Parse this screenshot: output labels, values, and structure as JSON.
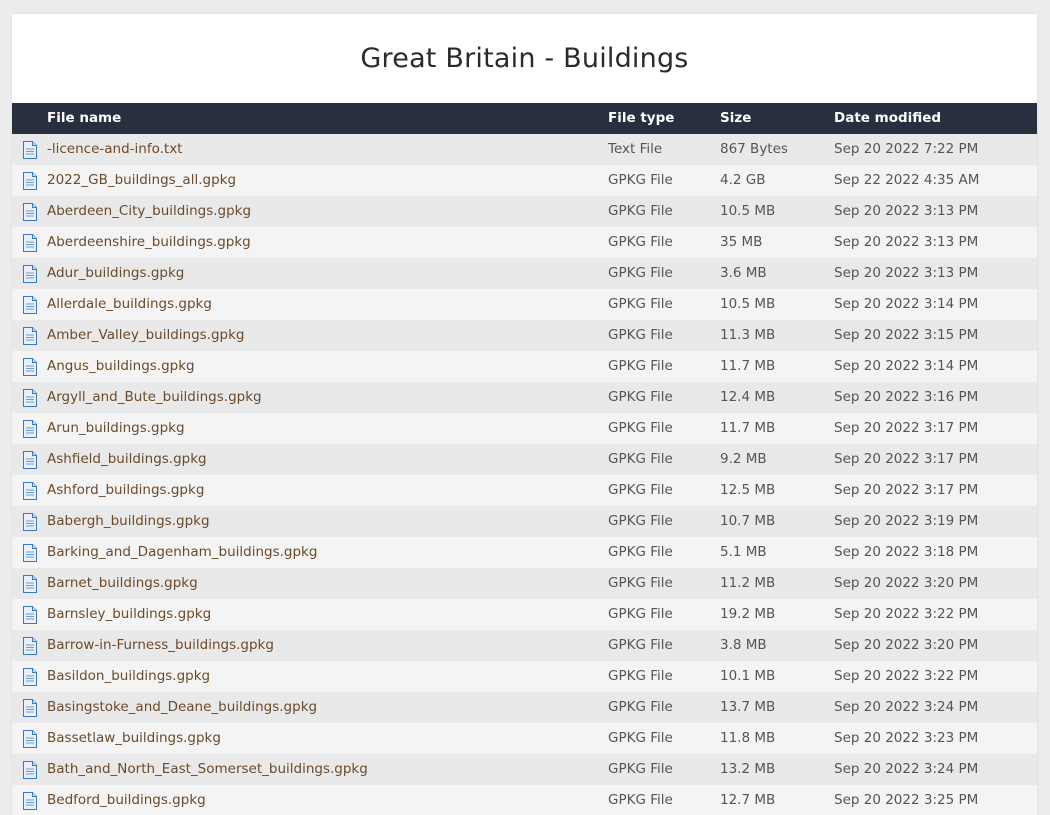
{
  "page": {
    "title": "Great Britain - Buildings"
  },
  "table": {
    "headers": {
      "name": "File name",
      "type": "File type",
      "size": "Size",
      "date": "Date modified"
    },
    "icon": "document-icon",
    "rows": [
      {
        "name": "-licence-and-info.txt",
        "type": "Text File",
        "size": "867 Bytes",
        "date": "Sep 20 2022 7:22 PM"
      },
      {
        "name": "2022_GB_buildings_all.gpkg",
        "type": "GPKG File",
        "size": "4.2 GB",
        "date": "Sep 22 2022 4:35 AM"
      },
      {
        "name": "Aberdeen_City_buildings.gpkg",
        "type": "GPKG File",
        "size": "10.5 MB",
        "date": "Sep 20 2022 3:13 PM"
      },
      {
        "name": "Aberdeenshire_buildings.gpkg",
        "type": "GPKG File",
        "size": "35 MB",
        "date": "Sep 20 2022 3:13 PM"
      },
      {
        "name": "Adur_buildings.gpkg",
        "type": "GPKG File",
        "size": "3.6 MB",
        "date": "Sep 20 2022 3:13 PM"
      },
      {
        "name": "Allerdale_buildings.gpkg",
        "type": "GPKG File",
        "size": "10.5 MB",
        "date": "Sep 20 2022 3:14 PM"
      },
      {
        "name": "Amber_Valley_buildings.gpkg",
        "type": "GPKG File",
        "size": "11.3 MB",
        "date": "Sep 20 2022 3:15 PM"
      },
      {
        "name": "Angus_buildings.gpkg",
        "type": "GPKG File",
        "size": "11.7 MB",
        "date": "Sep 20 2022 3:14 PM"
      },
      {
        "name": "Argyll_and_Bute_buildings.gpkg",
        "type": "GPKG File",
        "size": "12.4 MB",
        "date": "Sep 20 2022 3:16 PM"
      },
      {
        "name": "Arun_buildings.gpkg",
        "type": "GPKG File",
        "size": "11.7 MB",
        "date": "Sep 20 2022 3:17 PM"
      },
      {
        "name": "Ashfield_buildings.gpkg",
        "type": "GPKG File",
        "size": "9.2 MB",
        "date": "Sep 20 2022 3:17 PM"
      },
      {
        "name": "Ashford_buildings.gpkg",
        "type": "GPKG File",
        "size": "12.5 MB",
        "date": "Sep 20 2022 3:17 PM"
      },
      {
        "name": "Babergh_buildings.gpkg",
        "type": "GPKG File",
        "size": "10.7 MB",
        "date": "Sep 20 2022 3:19 PM"
      },
      {
        "name": "Barking_and_Dagenham_buildings.gpkg",
        "type": "GPKG File",
        "size": "5.1 MB",
        "date": "Sep 20 2022 3:18 PM"
      },
      {
        "name": "Barnet_buildings.gpkg",
        "type": "GPKG File",
        "size": "11.2 MB",
        "date": "Sep 20 2022 3:20 PM"
      },
      {
        "name": "Barnsley_buildings.gpkg",
        "type": "GPKG File",
        "size": "19.2 MB",
        "date": "Sep 20 2022 3:22 PM"
      },
      {
        "name": "Barrow-in-Furness_buildings.gpkg",
        "type": "GPKG File",
        "size": "3.8 MB",
        "date": "Sep 20 2022 3:20 PM"
      },
      {
        "name": "Basildon_buildings.gpkg",
        "type": "GPKG File",
        "size": "10.1 MB",
        "date": "Sep 20 2022 3:22 PM"
      },
      {
        "name": "Basingstoke_and_Deane_buildings.gpkg",
        "type": "GPKG File",
        "size": "13.7 MB",
        "date": "Sep 20 2022 3:24 PM"
      },
      {
        "name": "Bassetlaw_buildings.gpkg",
        "type": "GPKG File",
        "size": "11.8 MB",
        "date": "Sep 20 2022 3:23 PM"
      },
      {
        "name": "Bath_and_North_East_Somerset_buildings.gpkg",
        "type": "GPKG File",
        "size": "13.2 MB",
        "date": "Sep 20 2022 3:24 PM"
      },
      {
        "name": "Bedford_buildings.gpkg",
        "type": "GPKG File",
        "size": "12.7 MB",
        "date": "Sep 20 2022 3:25 PM"
      }
    ]
  }
}
